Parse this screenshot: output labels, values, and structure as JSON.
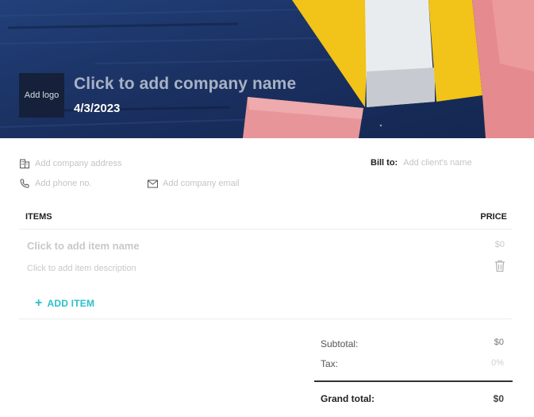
{
  "header": {
    "logo_label": "Add logo",
    "company_name": "Click to add company name",
    "date": "4/3/2023"
  },
  "contact": {
    "address_placeholder": "Add company address",
    "phone_placeholder": "Add phone no.",
    "email_placeholder": "Add company email",
    "bill_to_label": "Bill to:",
    "client_placeholder": "Add client's name"
  },
  "items_table": {
    "col_items": "ITEMS",
    "col_price": "PRICE",
    "rows": [
      {
        "name": "Click to add item name",
        "description": "Click to add item description",
        "price": "$0"
      }
    ],
    "add_item_label": "ADD ITEM"
  },
  "totals": {
    "subtotal_label": "Subtotal:",
    "subtotal_value": "$0",
    "tax_label": "Tax:",
    "tax_value": "0%",
    "grand_label": "Grand total:",
    "grand_value": "$0"
  },
  "colors": {
    "banner_blue": "#1d3563",
    "accent_teal": "#2bbfc9",
    "yellow": "#f2c318",
    "pink": "#e58a8e"
  },
  "icons": [
    "building-icon",
    "phone-icon",
    "mail-icon",
    "trash-icon",
    "plus-icon"
  ]
}
